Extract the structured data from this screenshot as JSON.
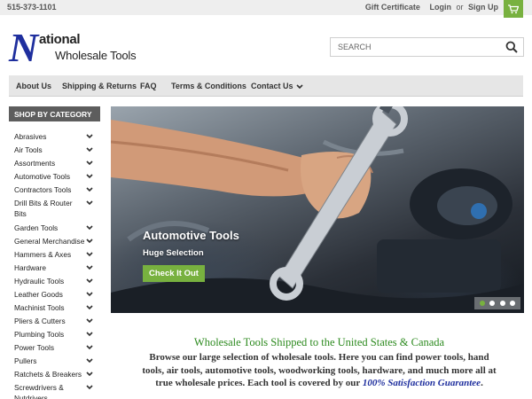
{
  "topbar": {
    "phone": "515-373-1101",
    "gift_certificate": "Gift Certificate",
    "login": "Login",
    "or": "or",
    "sign_up": "Sign Up"
  },
  "logo": {
    "big_letter": "N",
    "line1": "ational",
    "line2": "Wholesale Tools"
  },
  "search": {
    "placeholder": "SEARCH"
  },
  "nav": {
    "about": "About Us",
    "shipping": "Shipping & Returns",
    "faq": "FAQ",
    "terms": "Terms & Conditions",
    "contact": "Contact Us"
  },
  "sidebar": {
    "heading": "SHOP BY CATEGORY",
    "items": [
      {
        "label": "Abrasives"
      },
      {
        "label": "Air Tools"
      },
      {
        "label": "Assortments"
      },
      {
        "label": "Automotive Tools"
      },
      {
        "label": "Contractors Tools"
      },
      {
        "label": "Drill Bits & Router Bits"
      },
      {
        "label": "Garden Tools"
      },
      {
        "label": "General Merchandise"
      },
      {
        "label": "Hammers & Axes"
      },
      {
        "label": "Hardware"
      },
      {
        "label": "Hydraulic Tools"
      },
      {
        "label": "Leather Goods"
      },
      {
        "label": "Machinist Tools"
      },
      {
        "label": "Pliers & Cutters"
      },
      {
        "label": "Plumbing Tools"
      },
      {
        "label": "Power Tools"
      },
      {
        "label": "Pullers"
      },
      {
        "label": "Ratchets & Breakers"
      },
      {
        "label": "Screwdrivers & Nutdrivers"
      }
    ]
  },
  "hero": {
    "title": "Automotive Tools",
    "subtitle": "Huge Selection",
    "button": "Check It Out",
    "active_slide": 1,
    "slide_count": 4
  },
  "welcome": {
    "heading": "Wholesale Tools Shipped to the United States & Canada",
    "body_1": "Browse our large selection of wholesale tools. Here you can find power tools, hand tools, air tools, automotive tools, woodworking tools, hardware, and much more all at true wholesale prices. Each tool is covered by our ",
    "link": "100% Satisfaction Guarantee",
    "body_2": "."
  },
  "colors": {
    "accent": "#78b13f",
    "brand_blue": "#1f2f9e",
    "heading_green": "#2c8a1e"
  }
}
